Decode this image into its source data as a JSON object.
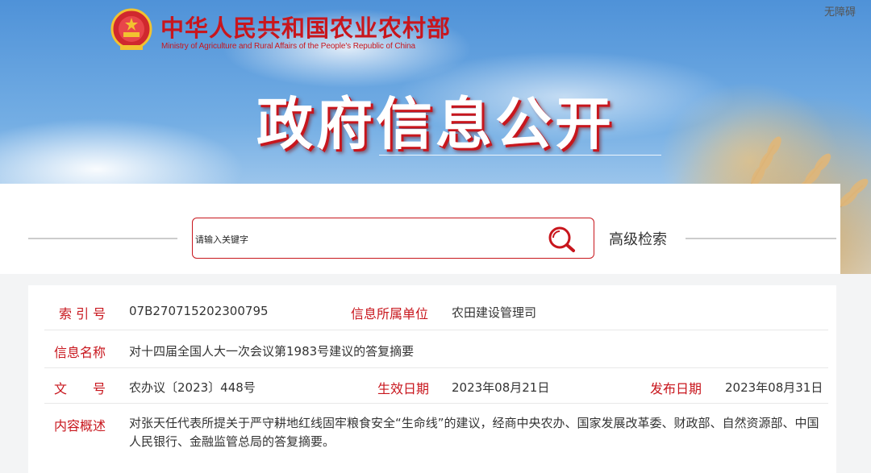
{
  "header": {
    "ministry_name_cn": "中华人民共和国农业农村部",
    "ministry_name_en": "Ministry of Agriculture and Rural Affairs of the People's Republic of China",
    "accessibility_link": "无障碍",
    "banner_title": "政府信息公开",
    "brand_color": "#c8161d"
  },
  "search": {
    "placeholder": "请输入关键字",
    "advanced_label": "高级检索",
    "icon": "search-icon"
  },
  "info": {
    "index_label": "索 引 号",
    "index_value": "07B270715202300795",
    "unit_label": "信息所属单位",
    "unit_value": "农田建设管理司",
    "name_label": "信息名称",
    "name_value": "对十四届全国人大一次会议第1983号建议的答复摘要",
    "doc_label": "文　　号",
    "doc_value": "农办议〔2023〕448号",
    "effective_label": "生效日期",
    "effective_value": "2023年08月21日",
    "publish_label": "发布日期",
    "publish_value": "2023年08月31日",
    "summary_label": "内容概述",
    "summary_value": "对张天任代表所提关于严守耕地红线固牢粮食安全“生命线”的建议，经商中央农办、国家发展改革委、财政部、自然资源部、中国人民银行、金融监管总局的答复摘要。"
  }
}
